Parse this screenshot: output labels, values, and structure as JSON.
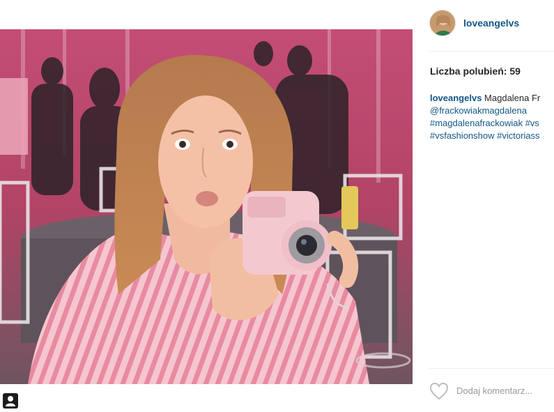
{
  "post": {
    "username": "loveangelvs",
    "likes_text": "Liczba polubień: 59",
    "caption": {
      "user": "loveangelvs",
      "text": " Magdalena Fr",
      "tag_line1": "@frackowiakmagdalena",
      "tag_line2": "#magdalenafrackowiak #vs",
      "tag_line3": "#vsfashionshow #victoriass"
    },
    "comment_placeholder": "Dodaj komentarz..."
  },
  "icons": {
    "tag": "person-tag-icon",
    "like": "heart-icon"
  },
  "colors": {
    "link": "#125688",
    "muted": "#999999",
    "text": "#262626"
  }
}
